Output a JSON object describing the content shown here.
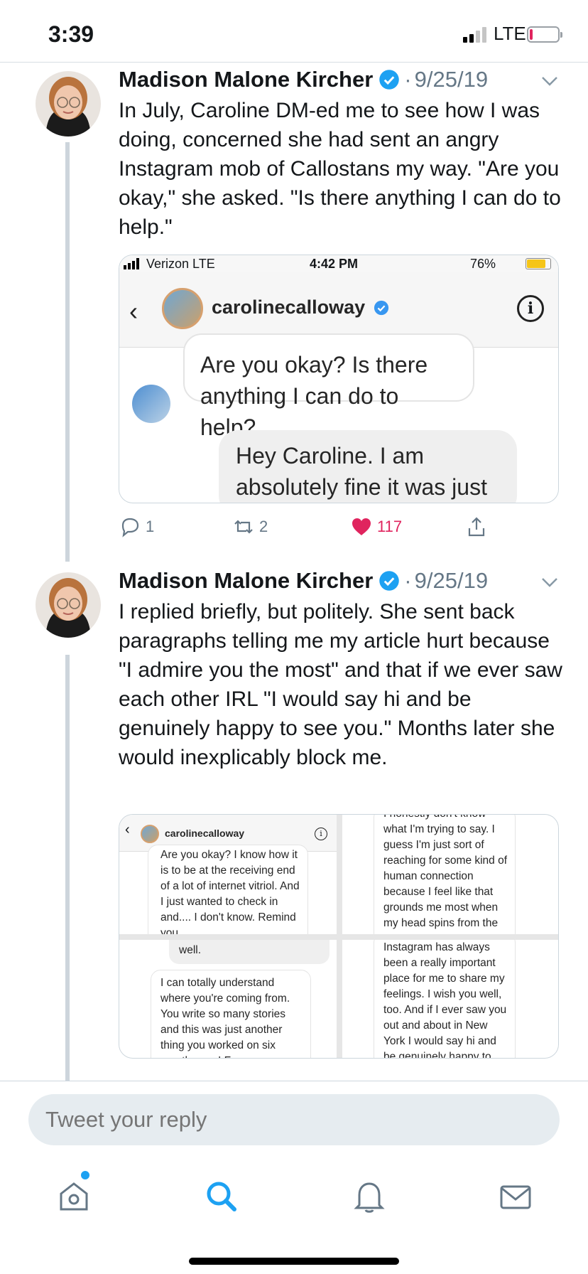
{
  "status_bar": {
    "time": "3:39",
    "network": "LTE"
  },
  "tweets": [
    {
      "author": "Madison Malone Kircher",
      "dot": "·",
      "date": "9/25/19",
      "text": "In July, Caroline DM-ed me to see how I was doing, concerned she had sent an angry Instagram mob of Callostans my way. \"Are you okay,\" she asked. \"Is there anything I can do to help.\"",
      "media": {
        "carrier": "Verizon  LTE",
        "time": "4:42 PM",
        "battery": "76%",
        "username": "carolinecalloway",
        "incoming_message": "Are you okay? Is there anything I can do to help?",
        "outgoing_message": "Hey Caroline. I am absolutely fine it was just"
      },
      "replies": "1",
      "retweets": "2",
      "likes": "117"
    },
    {
      "author": "Madison Malone Kircher",
      "dot": "·",
      "date": "9/25/19",
      "text": "I replied briefly, but politely. She sent back paragraphs telling me my article hurt because \"I admire you the most\" and that if we ever saw each other IRL \"I would say hi and be genuinely happy to see you.\" Months later she would inexplicably block me.",
      "collage": {
        "username": "carolinecalloway",
        "panel1": "Are you okay? I know how it is to be at the receiving end of a lot of internet vitriol. And I just wanted to check in and.... I don't know. Remind you",
        "panel2": "I honestly don't know what I'm trying to say. I guess I'm just sort of reaching for some kind of human connection because I feel like that grounds me most when my head spins from the",
        "panel3_grey": "well.",
        "panel3": "I can totally understand where you're coming from. You write so many stories and this was just another thing you worked on six months ago! For",
        "panel4": "Instagram has always been a really important place for me to share my feelings. I wish you well, too. And if I ever saw you out and about in New York I would say hi and be genuinely happy to"
      }
    }
  ],
  "reply": {
    "placeholder": "Tweet your reply"
  },
  "tabs": [
    "home-icon",
    "search-icon",
    "notifications-icon",
    "messages-icon"
  ],
  "colors": {
    "accent": "#1da1f2",
    "like": "#e0245e",
    "muted": "#657786"
  }
}
